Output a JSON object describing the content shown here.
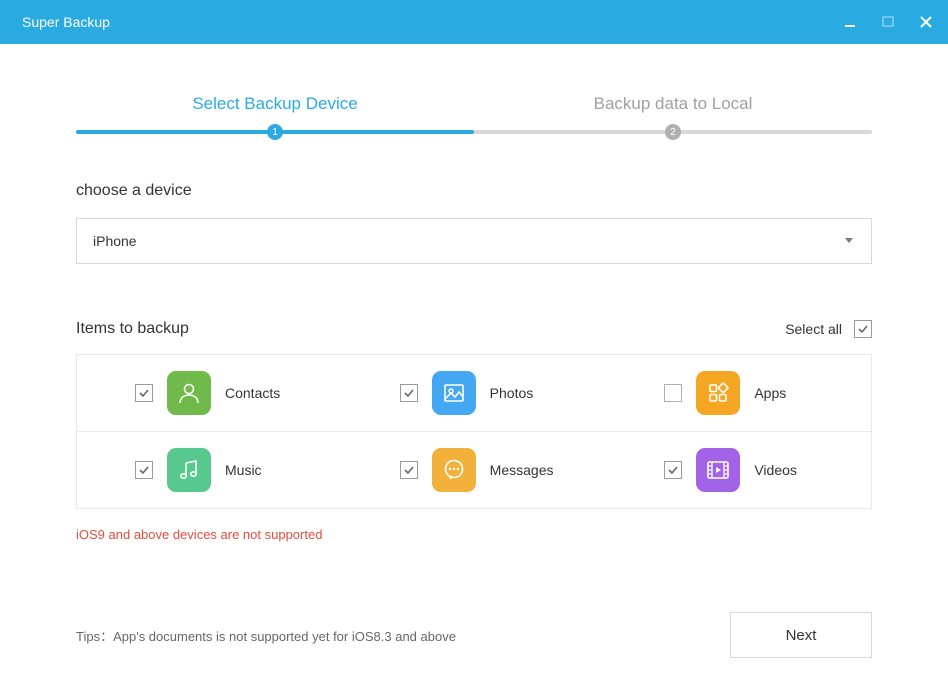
{
  "titlebar": {
    "title": "Super Backup"
  },
  "progress": {
    "step1_label": "Select Backup Device",
    "step2_label": "Backup data to Local",
    "node1": "1",
    "node2": "2"
  },
  "device": {
    "title": "choose a device",
    "selected": "iPhone"
  },
  "items": {
    "title": "Items to backup",
    "select_all_label": "Select all",
    "warning": "iOS9 and above devices are not supported",
    "rows": [
      [
        {
          "key": "contacts",
          "label": "Contacts",
          "checked": true,
          "color": "#6fba4a"
        },
        {
          "key": "photos",
          "label": "Photos",
          "checked": true,
          "color": "#44a7f2"
        },
        {
          "key": "apps",
          "label": "Apps",
          "checked": false,
          "color": "#f5a623"
        }
      ],
      [
        {
          "key": "music",
          "label": "Music",
          "checked": true,
          "color": "#58c98e"
        },
        {
          "key": "messages",
          "label": "Messages",
          "checked": true,
          "color": "#f2b13a"
        },
        {
          "key": "videos",
          "label": "Videos",
          "checked": true,
          "color": "#a363e8"
        }
      ]
    ]
  },
  "footer": {
    "tips": "Tips：App's documents is not supported yet for iOS8.3 and above",
    "next_label": "Next"
  },
  "colors": {
    "accent": "#29abe2"
  }
}
